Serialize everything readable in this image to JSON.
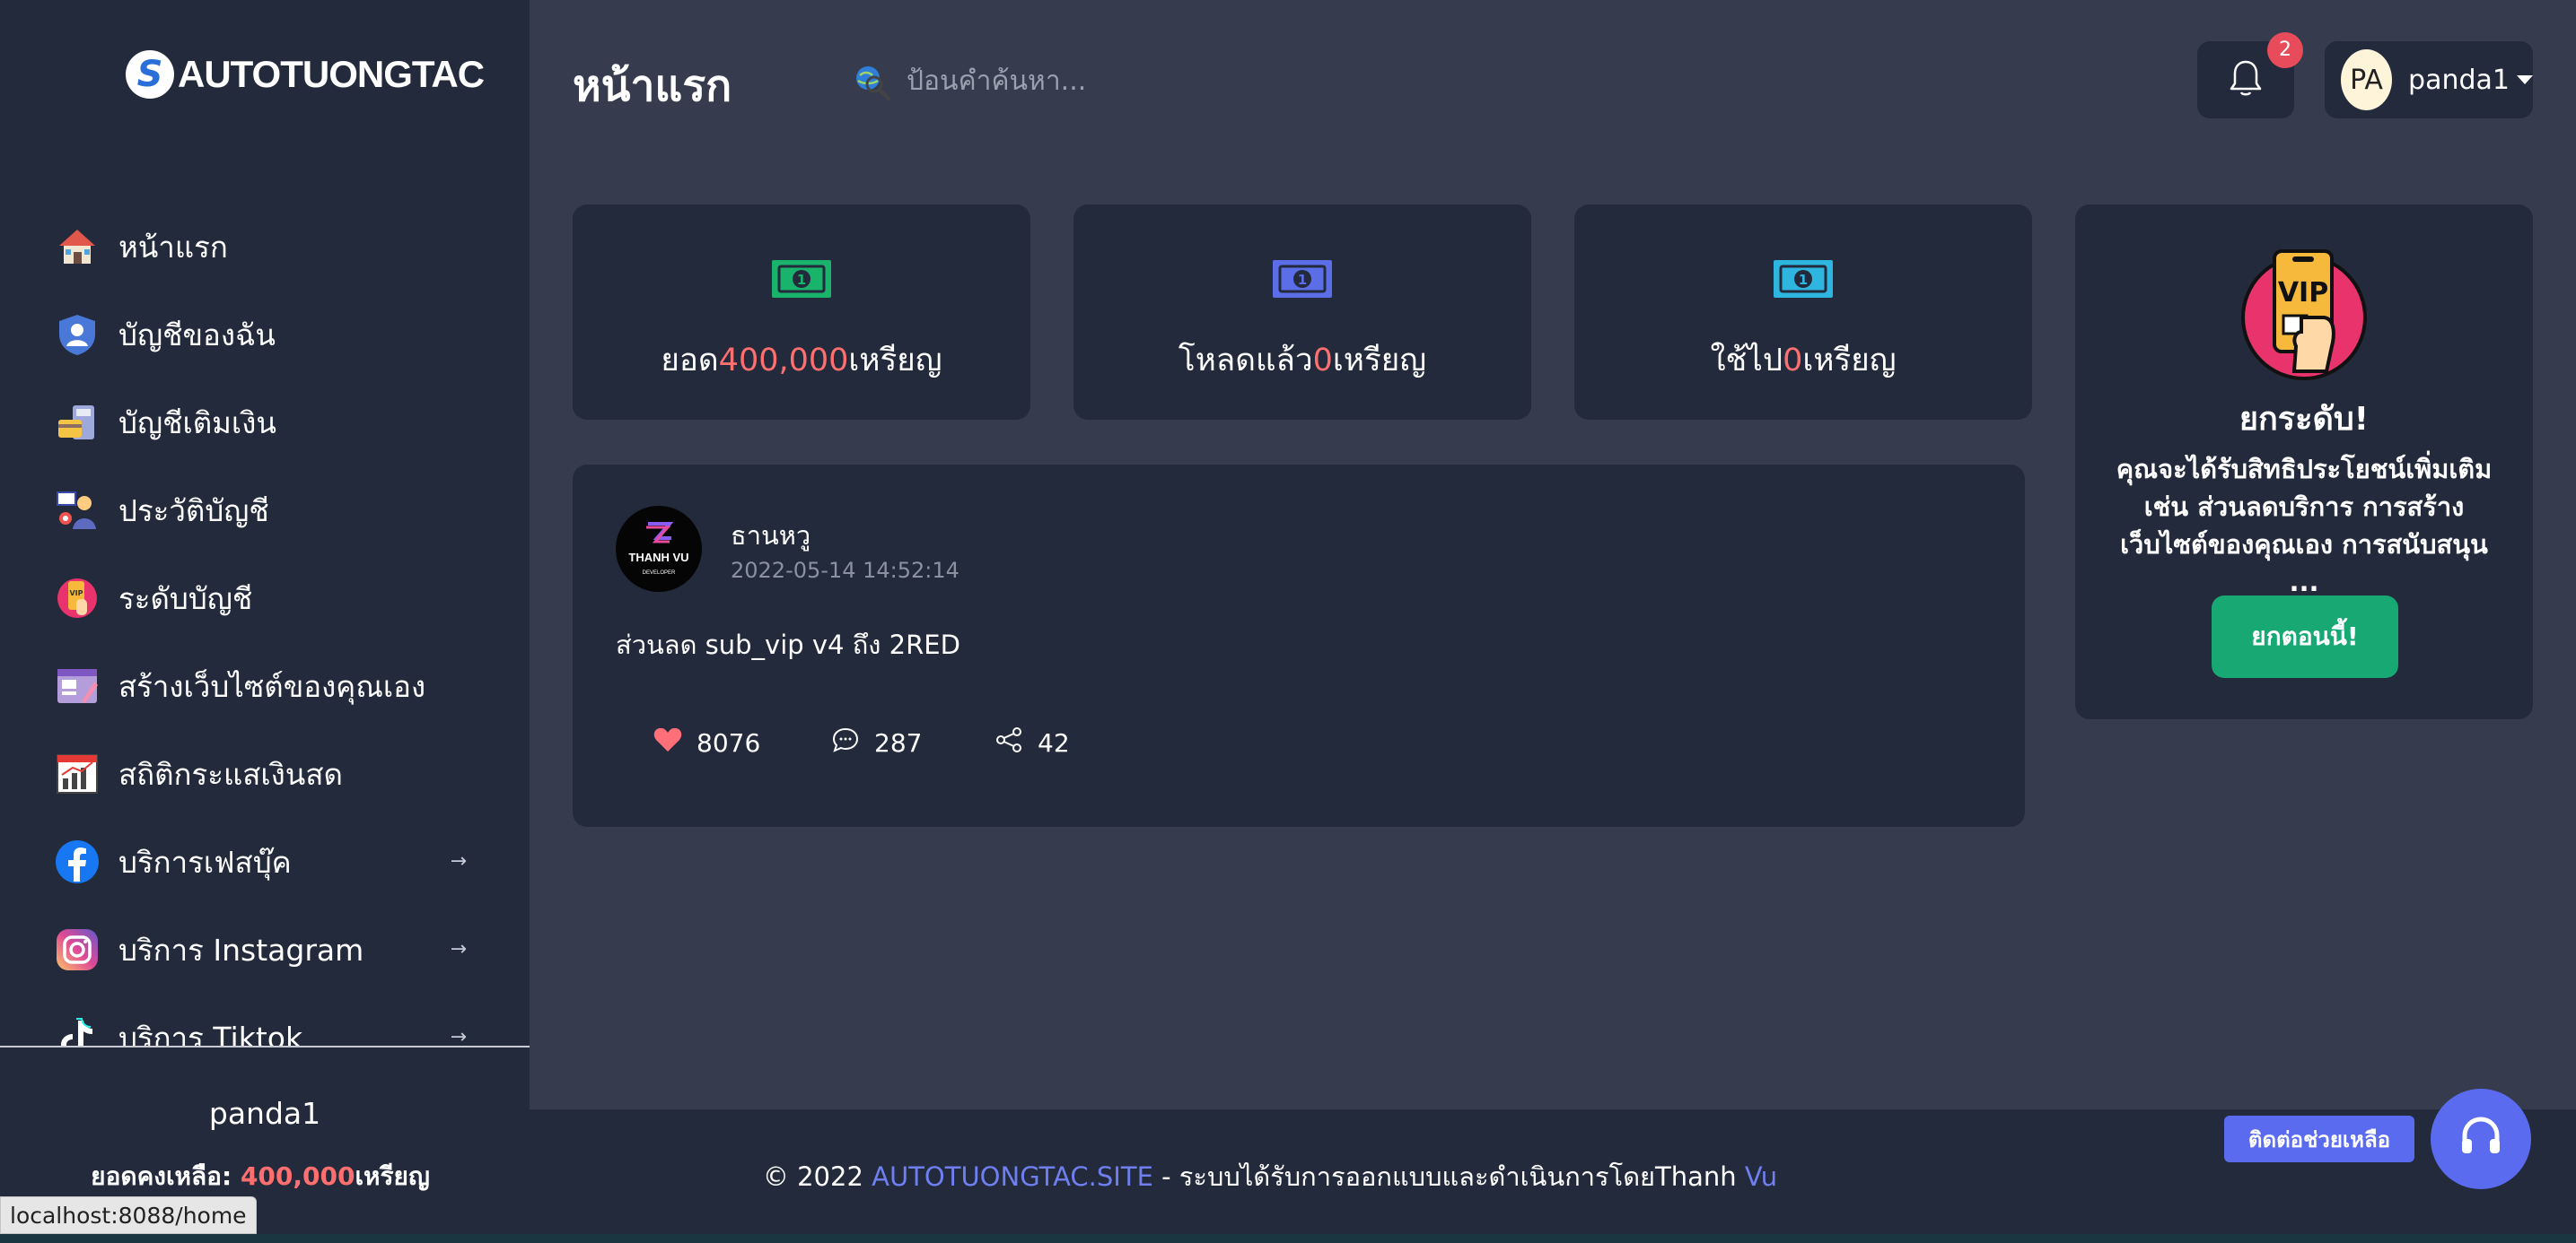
{
  "sidebar": {
    "logo_text": "AUTOTUONGTAC",
    "logo_mark": "S",
    "items": [
      {
        "label": "หน้าแรก",
        "icon": "home-icon",
        "has_arrow": false
      },
      {
        "label": "บัญชีของฉัน",
        "icon": "user-shield-icon",
        "has_arrow": false
      },
      {
        "label": "บัญชีเติมเงิน",
        "icon": "topup-icon",
        "has_arrow": false
      },
      {
        "label": "ประวัติบัญชี",
        "icon": "history-icon",
        "has_arrow": false
      },
      {
        "label": "ระดับบัญชี",
        "icon": "vip-level-icon",
        "has_arrow": false
      },
      {
        "label": "สร้างเว็บไซต์ของคุณเอง",
        "icon": "website-builder-icon",
        "has_arrow": false
      },
      {
        "label": "สถิติกระแสเงินสด",
        "icon": "cashflow-chart-icon",
        "has_arrow": false
      },
      {
        "label": "บริการเฟสบุ๊ค",
        "icon": "facebook-icon",
        "has_arrow": true
      },
      {
        "label": "บริการ Instagram",
        "icon": "instagram-icon",
        "has_arrow": true
      },
      {
        "label": "บริการ Tiktok",
        "icon": "tiktok-icon",
        "has_arrow": true
      }
    ],
    "arrow_glyph": "→",
    "username": "panda1",
    "balance_label": "ยอดคงเหลือ: ",
    "balance_value": "400,000",
    "balance_unit": "เหรียญ"
  },
  "status_bar_url": "localhost:8088/home",
  "header": {
    "title": "หน้าแรก",
    "search_placeholder": "ป้อนคำค้นหา...",
    "notification_count": "2",
    "avatar_initials": "PA",
    "username": "panda1"
  },
  "stats": [
    {
      "prefix": "ยอด",
      "value": "400,000",
      "suffix": "เหรียญ",
      "icon_color": "#19b36b"
    },
    {
      "prefix": "โหลดแล้ว",
      "value": "0",
      "suffix": "เหรียญ",
      "icon_color": "#5b6ee8"
    },
    {
      "prefix": "ใช้ไป",
      "value": "0",
      "suffix": "เหรียญ",
      "icon_color": "#2fb6e0"
    }
  ],
  "vip": {
    "badge_text": "VIP",
    "title": "ยกระดับ!",
    "description": "คุณจะได้รับสิทธิประโยชน์เพิ่มเติม เช่น ส่วนลดบริการ การสร้างเว็บไซต์ของคุณเอง การสนับสนุน ...",
    "button_label": "ยกตอนนี้!"
  },
  "post": {
    "avatar_title": "THANH VU",
    "avatar_subtitle": "DEVELOPER",
    "author": "ธานหวู",
    "timestamp": "2022-05-14 14:52:14",
    "content": "ส่วนลด sub_vip v4 ถึง 2RED",
    "likes": "8076",
    "comments": "287",
    "shares": "42"
  },
  "footer": {
    "copyright": "© 2022 ",
    "site": "AUTOTUONGTAC.SITE",
    "middle": " - ระบบได้รับการออกแบบและดำเนินการโดยThanh ",
    "author_last": "Vu"
  },
  "help": {
    "button_label": "ติดต่อช่วยเหลือ"
  },
  "colors": {
    "sidebar_bg": "#222a3b",
    "main_bg": "#363c4d",
    "accent_red": "#ff6f6f",
    "accent_blue": "#6f7ff0",
    "vip_button": "#18a873",
    "badge": "#e84b5a"
  }
}
